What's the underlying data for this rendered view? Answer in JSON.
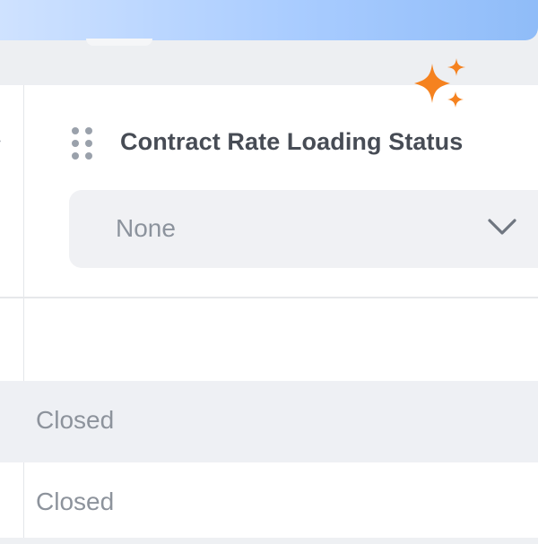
{
  "column": {
    "title": "Contract Rate Loading Status",
    "select_value": "None"
  },
  "rows": [
    {
      "status": "Closed"
    },
    {
      "status": "Closed"
    }
  ],
  "colors": {
    "accent_orange": "#f5821f",
    "title_text": "#474c55",
    "muted_text": "#8d939c"
  },
  "icons": {
    "drag": "drag-handle-icon",
    "sparkle": "sparkle-icon",
    "dropdown": "chevron-down-icon"
  }
}
